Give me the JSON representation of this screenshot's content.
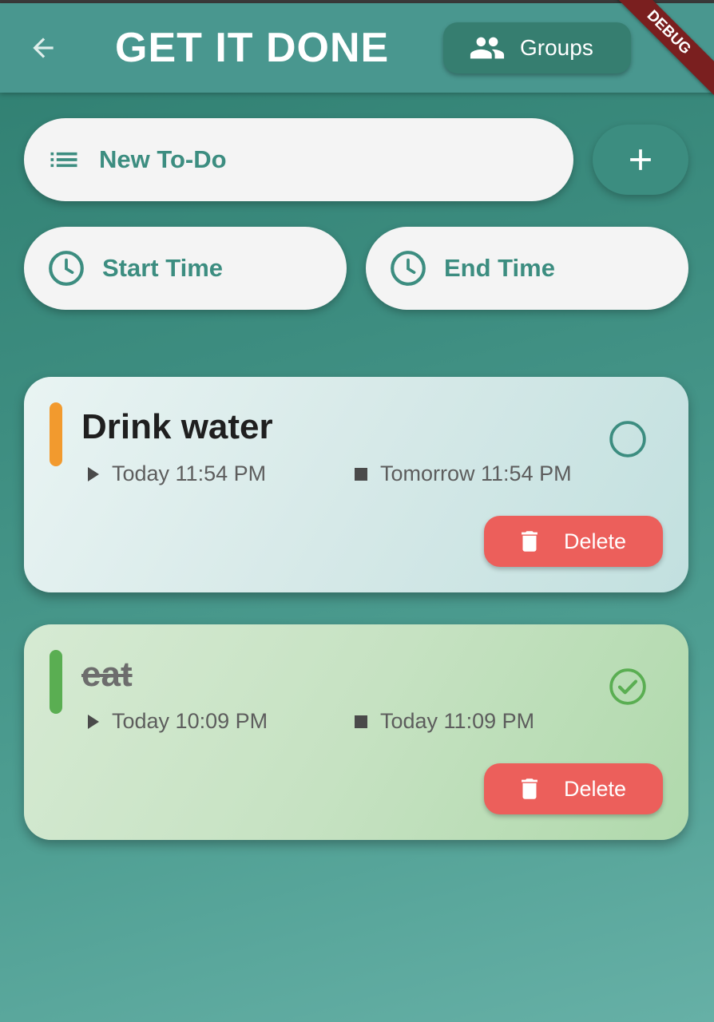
{
  "app": {
    "title": "GET IT DONE",
    "groups_label": "Groups",
    "debug_banner": "DEBUG"
  },
  "new_todo": {
    "placeholder": "New To-Do"
  },
  "start_time": {
    "label": "Start Time"
  },
  "end_time": {
    "label": "End Time"
  },
  "todos": [
    {
      "title": "Drink water",
      "start": "Today 11:54 PM",
      "end": "Tomorrow 11:54 PM",
      "completed": false,
      "priority_color": "#f29a2e",
      "delete_label": "Delete"
    },
    {
      "title": "eat",
      "start": "Today 10:09 PM",
      "end": "Today 11:09 PM",
      "completed": true,
      "priority_color": "#5aae52",
      "delete_label": "Delete"
    }
  ],
  "colors": {
    "accent": "#3c8d80",
    "delete": "#ec5f5b",
    "check_green": "#5aae52"
  }
}
